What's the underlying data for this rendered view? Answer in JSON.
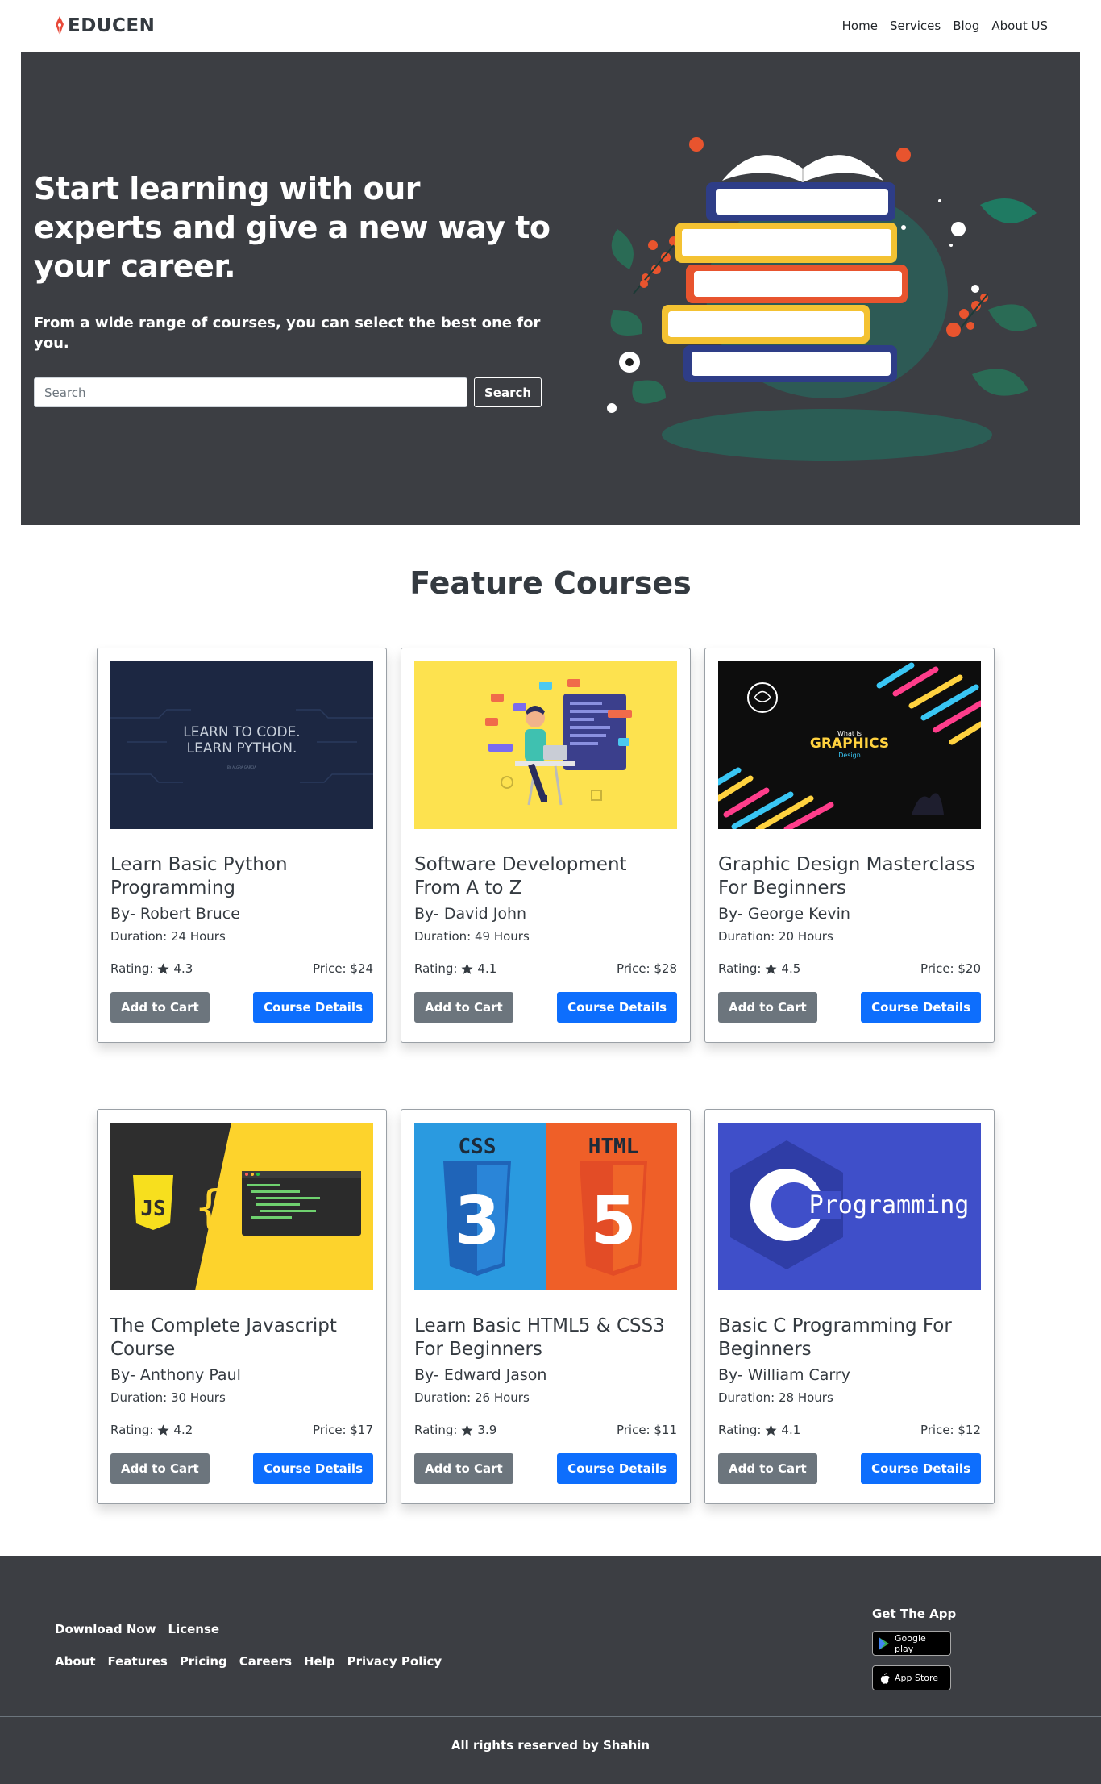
{
  "brand": {
    "name": "EDUCEN"
  },
  "nav": {
    "items": [
      "Home",
      "Services",
      "Blog",
      "About US"
    ]
  },
  "hero": {
    "title": "Start learning with our experts and give a new way to your career.",
    "subtitle": "From a wide range of courses, you can select the best one for you.",
    "search_placeholder": "Search",
    "search_button": "Search"
  },
  "features": {
    "title": "Feature Courses",
    "cards": [
      {
        "title": "Learn Basic Python Programming",
        "author": "By- Robert Bruce",
        "duration": "Duration: 24 Hours",
        "rating_label": "Rating:",
        "rating": "4.3",
        "price": "Price: $24",
        "cart_label": "Add to Cart",
        "details_label": "Course Details",
        "image_text_1": "LEARN TO CODE.",
        "image_text_2": "LEARN PYTHON.",
        "image_text_3": "BY ALGRA GARCIA"
      },
      {
        "title": "Software Development From A to Z",
        "author": "By- David John",
        "duration": "Duration: 49 Hours",
        "rating_label": "Rating:",
        "rating": "4.1",
        "price": "Price: $28",
        "cart_label": "Add to Cart",
        "details_label": "Course Details"
      },
      {
        "title": "Graphic Design Masterclass For Beginners",
        "author": "By- George Kevin",
        "duration": "Duration: 20 Hours",
        "rating_label": "Rating:",
        "rating": "4.5",
        "price": "Price: $20",
        "cart_label": "Add to Cart",
        "details_label": "Course Details",
        "image_text_1": "What is",
        "image_text_2": "GRAPHICS",
        "image_text_3": "Design"
      },
      {
        "title": "The Complete Javascript Course",
        "author": "By- Anthony Paul",
        "duration": "Duration: 30 Hours",
        "rating_label": "Rating:",
        "rating": "4.2",
        "price": "Price: $17",
        "cart_label": "Add to Cart",
        "details_label": "Course Details",
        "image_text_1": "JS"
      },
      {
        "title": "Learn Basic HTML5 & CSS3 For Beginners",
        "author": "By- Edward Jason",
        "duration": "Duration: 26 Hours",
        "rating_label": "Rating:",
        "rating": "3.9",
        "price": "Price: $11",
        "cart_label": "Add to Cart",
        "details_label": "Course Details",
        "image_text_1": "CSS",
        "image_text_2": "HTML",
        "image_text_3": "3",
        "image_text_4": "5"
      },
      {
        "title": "Basic C Programming For Beginners",
        "author": "By- William Carry",
        "duration": "Duration: 28 Hours",
        "rating_label": "Rating:",
        "rating": "4.1",
        "price": "Price: $12",
        "cart_label": "Add to Cart",
        "details_label": "Course Details",
        "image_text_1": "Programming"
      }
    ]
  },
  "footer": {
    "links_row1": [
      "Download Now",
      "License"
    ],
    "links_row2": [
      "About",
      "Features",
      "Pricing",
      "Careers",
      "Help",
      "Privacy Policy"
    ],
    "app_title": "Get The App",
    "google_play_label": "Google play",
    "app_store_label": "App Store",
    "copyright": "All rights reserved by Shahin"
  },
  "colors": {
    "hero_bg": "#3c3e43",
    "primary_button": "#0d6efd",
    "secondary_button": "#6c757d",
    "star": "#343a40"
  }
}
